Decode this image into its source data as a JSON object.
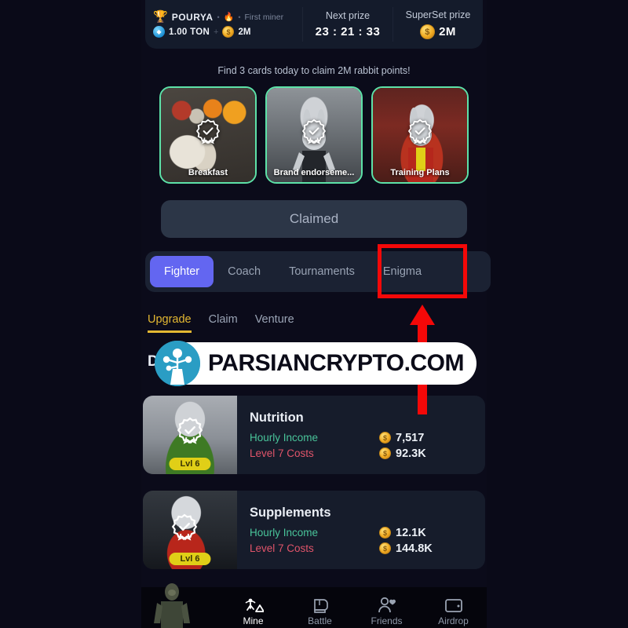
{
  "topbar": {
    "trophy_icon": "trophy-icon",
    "username": "POURYA",
    "fire_icon": "fire-icon",
    "rank_label": "First miner",
    "ton_icon": "ton-coin-icon",
    "ton_amount": "1.00 TON",
    "plus": "+",
    "coin_icon": "gold-coin-icon",
    "coin_amount": "2M",
    "next_prize_label": "Next prize",
    "next_prize_value": "23 : 21 : 33",
    "superset_prize_label": "SuperSet prize",
    "superset_prize_value": "2M"
  },
  "cards_section": {
    "headline": "Find 3 cards today to claim 2M rabbit points!",
    "cards": [
      {
        "label": "Breakfast",
        "badge_icon": "verified-badge-icon"
      },
      {
        "label": "Brand endorseme...",
        "badge_icon": "verified-badge-icon"
      },
      {
        "label": "Training Plans",
        "badge_icon": "verified-badge-icon"
      }
    ]
  },
  "claim_button": {
    "label": "Claimed"
  },
  "segmented_tabs": {
    "items": [
      {
        "label": "Fighter",
        "active": true
      },
      {
        "label": "Coach",
        "active": false
      },
      {
        "label": "Tournaments",
        "active": false
      },
      {
        "label": "Enigma",
        "active": false
      }
    ]
  },
  "sub_tabs": {
    "items": [
      {
        "label": "Upgrade",
        "active": true
      },
      {
        "label": "Claim",
        "active": false
      },
      {
        "label": "Venture",
        "active": false
      }
    ]
  },
  "section_title": "D",
  "items": [
    {
      "name": "Nutrition",
      "level_badge": "Lvl 6",
      "income_label": "Hourly Income",
      "income_value": "7,517",
      "cost_label": "Level 7 Costs",
      "cost_value": "92.3K",
      "coin_icon": "gold-coin-icon"
    },
    {
      "name": "Supplements",
      "level_badge": "Lvl 6",
      "income_label": "Hourly Income",
      "income_value": "12.1K",
      "cost_label": "Level 7 Costs",
      "cost_value": "144.8K",
      "coin_icon": "gold-coin-icon"
    }
  ],
  "bottom_nav": {
    "items": [
      {
        "label": "Mine",
        "icon": "mine-pickaxe-icon",
        "active": true
      },
      {
        "label": "Battle",
        "icon": "boxing-glove-icon",
        "active": false
      },
      {
        "label": "Friends",
        "icon": "friends-icon",
        "active": false
      },
      {
        "label": "Airdrop",
        "icon": "wallet-icon",
        "active": false
      }
    ]
  },
  "annotations": {
    "highlight_color": "#f40808",
    "arrow_color": "#f40808",
    "highlight_target": "Enigma"
  },
  "watermark": {
    "text": "PARSIANCRYPTO.COM",
    "logo_icon": "parsiancrypto-logo-icon"
  },
  "colors": {
    "background": "#0a0a18",
    "panel": "#161c2b",
    "accent_purple": "#6366f1",
    "accent_gold": "#e3b832",
    "income_green": "#49c49a",
    "cost_red": "#e0546a",
    "card_border_green": "#5de2a8"
  }
}
